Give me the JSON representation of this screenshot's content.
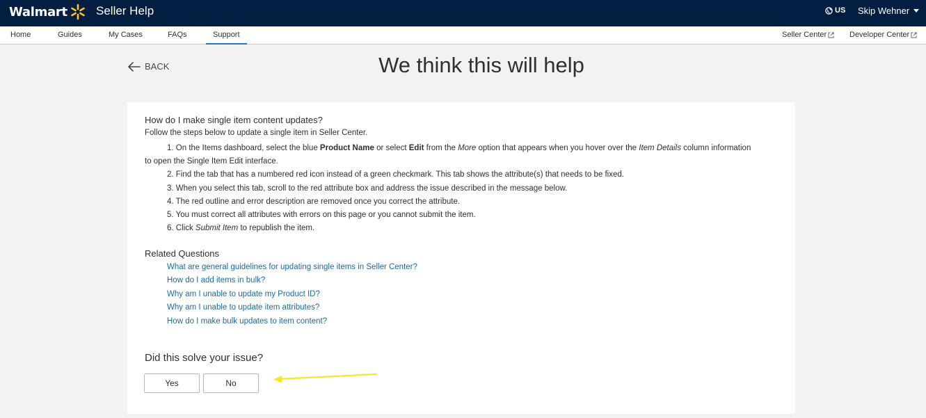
{
  "header": {
    "brand": "Walmart",
    "app_title": "Seller Help",
    "locale": "US",
    "user_name": "Skip Wehner"
  },
  "nav": {
    "items": [
      {
        "label": "Home"
      },
      {
        "label": "Guides"
      },
      {
        "label": "My Cases"
      },
      {
        "label": "FAQs"
      },
      {
        "label": "Support"
      }
    ],
    "active": "Support",
    "external_links": [
      {
        "label": "Seller Center"
      },
      {
        "label": "Developer Center"
      }
    ]
  },
  "page": {
    "back_label": "BACK",
    "title": "We think this will help"
  },
  "article": {
    "question": "How do I make single item content updates?",
    "intro": "Follow the steps below to update a single item in Seller Center.",
    "steps": {
      "s1": {
        "a": "1. On the Items dashboard, select the blue ",
        "b": "Product Name",
        "c": " or select ",
        "d": "Edit",
        "e": " from the ",
        "f": "More",
        "g": " option that appears when you hover over the ",
        "h": "Item Details",
        "i": " column information",
        "j": "to open the Single Item Edit interface."
      },
      "s2": "2. Find the tab that has a numbered red icon instead of a green checkmark. This tab shows the attribute(s) that needs to be fixed.",
      "s3": "3. When you select this tab, scroll to the red attribute box and address the issue described in the message below.",
      "s4": "4. The red outline and error description are removed once you correct the attribute.",
      "s5": "5. You must correct all attributes with errors on this page or you cannot submit the item.",
      "s6": {
        "a": "6. Click ",
        "b": "Submit Item",
        "c": " to republish the item."
      }
    }
  },
  "related": {
    "title": "Related Questions",
    "links": [
      "What are general guidelines for updating single items in Seller Center?",
      "How do I add items in bulk?",
      "Why am I unable to update my Product ID?",
      "Why am I unable to update item attributes?",
      "How do I make bulk updates to item content?"
    ]
  },
  "feedback": {
    "question": "Did this solve your issue?",
    "yes_label": "Yes",
    "no_label": "No"
  },
  "colors": {
    "header_bg": "#041e42",
    "spark": "#ffc220",
    "link": "#1a6aa8",
    "active_tab": "#1a75cf",
    "annotation_arrow": "#f5e62a"
  }
}
